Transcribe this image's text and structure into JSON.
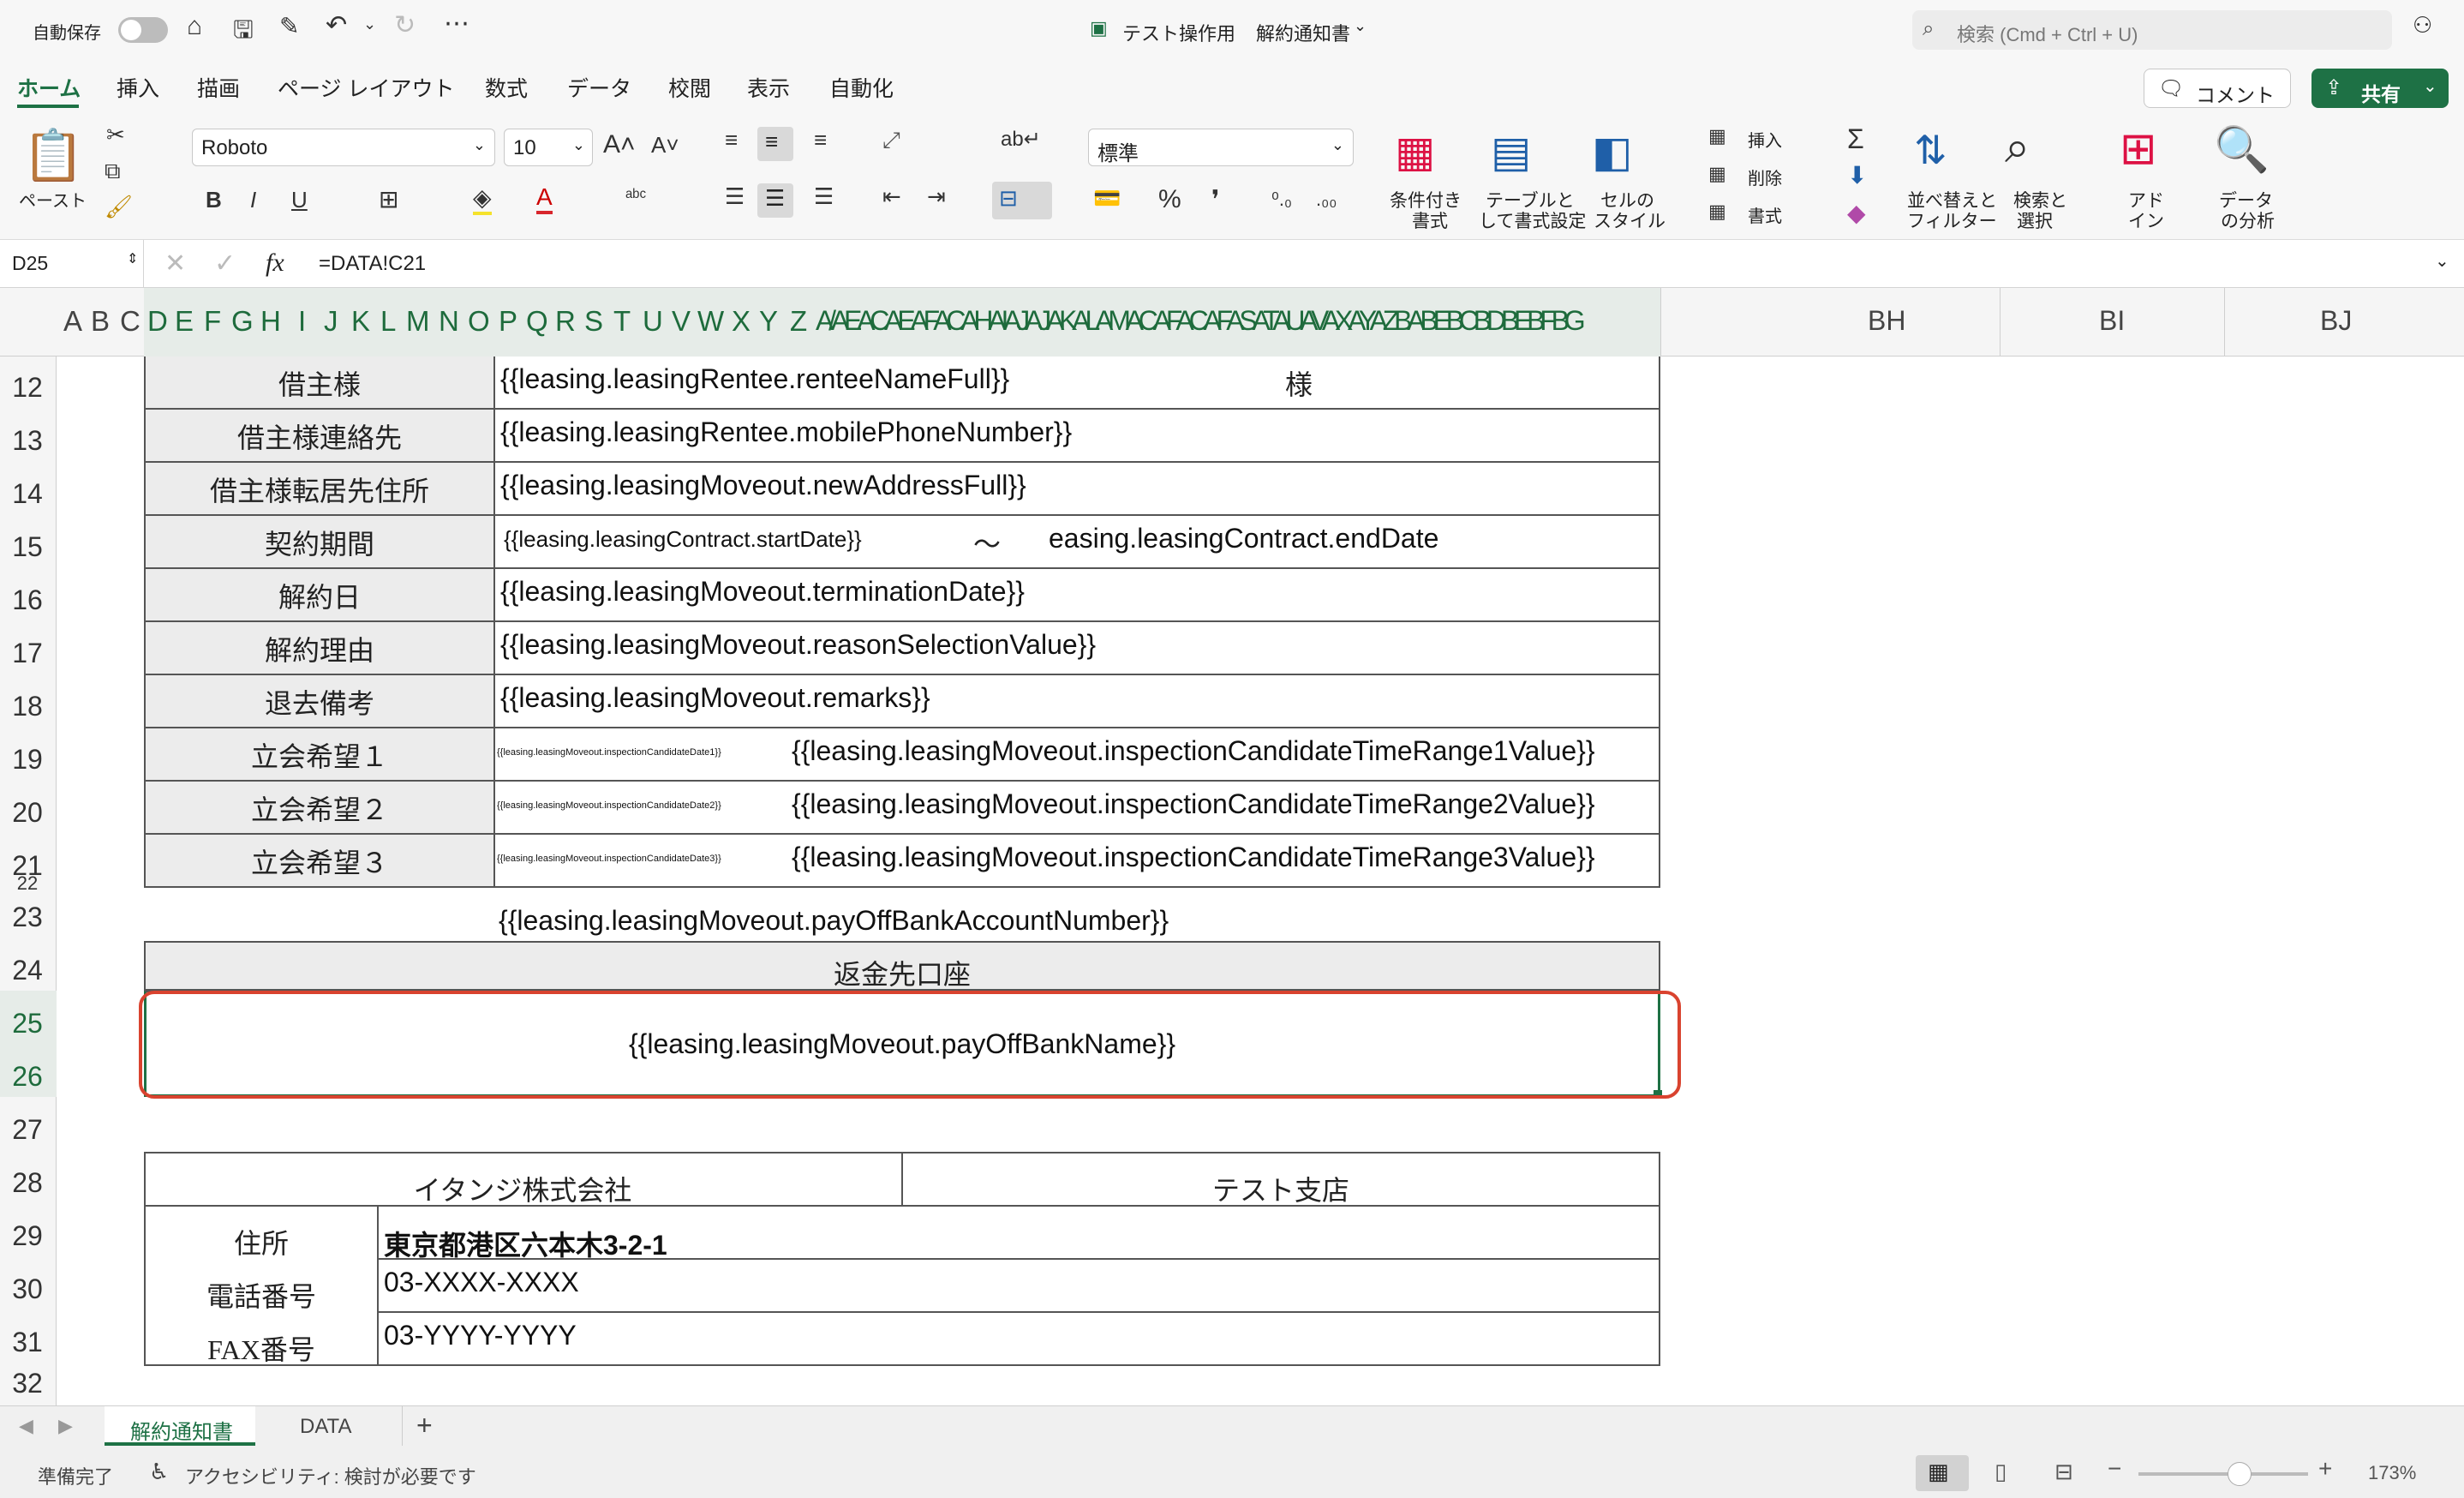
{
  "titlebar": {
    "autosave_label": "自動保存",
    "file_name": "テスト操作用",
    "doc_name": "解約通知書",
    "search_placeholder": "検索 (Cmd + Ctrl + U)"
  },
  "menu": {
    "tabs": [
      "ホーム",
      "挿入",
      "描画",
      "ページ レイアウト",
      "数式",
      "データ",
      "校閲",
      "表示",
      "自動化"
    ],
    "comment_label": "コメント",
    "share_label": "共有"
  },
  "ribbon": {
    "paste_label": "ペースト",
    "font_name": "Roboto",
    "font_size": "10",
    "number_format": "標準",
    "conditional_format_label": [
      "条件付き",
      "書式"
    ],
    "table_format_label": [
      "テーブルと",
      "して書式設定"
    ],
    "cell_style_label": [
      "セルの",
      "スタイル"
    ],
    "insert_label": "挿入",
    "delete_label": "削除",
    "format_label": "書式",
    "sort_filter_label": [
      "並べ替えと",
      "フィルター"
    ],
    "find_select_label": [
      "検索と",
      "選択"
    ],
    "addin_label": [
      "アド",
      "イン"
    ],
    "analyze_label": [
      "データ",
      "の分析"
    ]
  },
  "formula_bar": {
    "name_box": "D25",
    "formula": "=DATA!C21"
  },
  "columns": {
    "letters": [
      "A",
      "B",
      "C",
      "D",
      "E",
      "F",
      "G",
      "H",
      "I",
      "J",
      "K",
      "L",
      "M",
      "N",
      "O",
      "P",
      "Q",
      "R",
      "S",
      "T",
      "U",
      "V",
      "W",
      "X",
      "Y",
      "Z"
    ],
    "tail_cluster": "A/AEACAEAFACAHAIAJAJAKALAMACAFACAFASATAUAVAXAYAZBABEBCBDBEBFBG",
    "wide": [
      "BH",
      "BI",
      "BJ"
    ]
  },
  "rows": [
    "12",
    "13",
    "14",
    "15",
    "16",
    "17",
    "18",
    "19",
    "20",
    "21",
    "22",
    "23",
    "24",
    "25",
    "26",
    "27",
    "28",
    "29",
    "30",
    "31",
    "32"
  ],
  "form": {
    "rows": [
      {
        "label": "借主様",
        "value": "{{leasing.leasingRentee.renteeNameFull}}",
        "suffix": "様"
      },
      {
        "label": "借主様連絡先",
        "value": "{{leasing.leasingRentee.mobilePhoneNumber}}"
      },
      {
        "label": "借主様転居先住所",
        "value": "{{leasing.leasingMoveout.newAddressFull}}"
      },
      {
        "label": "契約期間",
        "value": "{{leasing.leasingContract.startDate}}",
        "tilde": "～",
        "value2": "easing.leasingContract.endDate"
      },
      {
        "label": "解約日",
        "value": "{{leasing.leasingMoveout.terminationDate}}"
      },
      {
        "label": "解約理由",
        "value": "{{leasing.leasingMoveout.reasonSelectionValue}}"
      },
      {
        "label": "退去備考",
        "value": "{{leasing.leasingMoveout.remarks}}"
      },
      {
        "label": "立会希望１",
        "small": "{{leasing.leasingMoveout.inspectionCandidateDate1}}",
        "value": "{{leasing.leasingMoveout.inspectionCandidateTimeRange1Value}}"
      },
      {
        "label": "立会希望２",
        "small": "{{leasing.leasingMoveout.inspectionCandidateDate2}}",
        "value": "{{leasing.leasingMoveout.inspectionCandidateTimeRange2Value}}"
      },
      {
        "label": "立会希望３",
        "small": "{{leasing.leasingMoveout.inspectionCandidateDate3}}",
        "value": "{{leasing.leasingMoveout.inspectionCandidateTimeRange3Value}}"
      }
    ],
    "account_number": "{{leasing.leasingMoveout.payOffBankAccountNumber}}",
    "refund_header": "返金先口座",
    "bank_name": "{{leasing.leasingMoveout.payOffBankName}}",
    "company": "イタンジ株式会社",
    "branch": "テスト支店",
    "address_label": "住所",
    "address_value": "東京都港区六本木3-2-1",
    "phone_label": "電話番号",
    "phone_value": "03-XXXX-XXXX",
    "fax_label": "FAX番号",
    "fax_value": "03-YYYY-YYYY"
  },
  "sheet_tabs": [
    "解約通知書",
    "DATA"
  ],
  "status": {
    "ready": "準備完了",
    "accessibility": "アクセシビリティ: 検討が必要です",
    "zoom": "173%"
  },
  "colors": {
    "accent": "#1e7145",
    "highlight": "#d9432f"
  }
}
